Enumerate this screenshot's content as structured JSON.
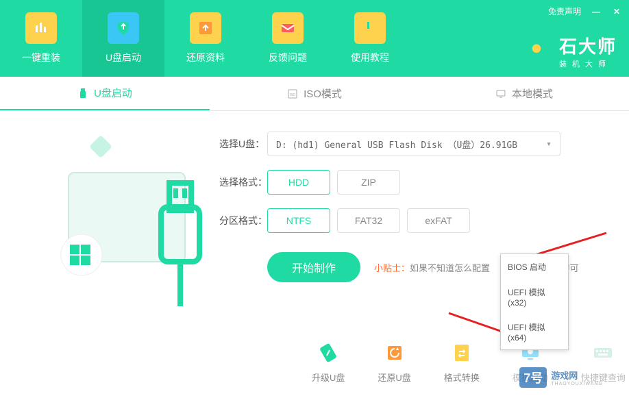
{
  "window": {
    "disclaimer": "免责声明",
    "minimize": "—",
    "close": "✕"
  },
  "brand": {
    "title": "石大师",
    "subtitle": "装机大师"
  },
  "nav": [
    {
      "label": "一键重装",
      "name": "nav-reinstall"
    },
    {
      "label": "U盘启动",
      "name": "nav-usb-boot"
    },
    {
      "label": "还原资料",
      "name": "nav-restore"
    },
    {
      "label": "反馈问题",
      "name": "nav-feedback"
    },
    {
      "label": "使用教程",
      "name": "nav-tutorial"
    }
  ],
  "modes": [
    {
      "label": "U盘启动",
      "name": "mode-usb"
    },
    {
      "label": "ISO模式",
      "name": "mode-iso"
    },
    {
      "label": "本地模式",
      "name": "mode-local"
    }
  ],
  "form": {
    "select_label": "选择U盘：",
    "select_value": "D: (hd1) General USB Flash Disk （U盘）26.91GB",
    "format_label": "选择格式：",
    "format_options": [
      "HDD",
      "ZIP"
    ],
    "partition_label": "分区格式：",
    "partition_options": [
      "NTFS",
      "FAT32",
      "exFAT"
    ]
  },
  "action": {
    "start": "开始制作",
    "tip_label": "小贴士：",
    "tip_text": "如果不知道怎么配置",
    "tip_tail": "即可"
  },
  "tools": [
    {
      "label": "升级U盘",
      "name": "tool-upgrade"
    },
    {
      "label": "还原U盘",
      "name": "tool-restore"
    },
    {
      "label": "格式转换",
      "name": "tool-convert"
    },
    {
      "label": "模拟启动",
      "name": "tool-simulate"
    },
    {
      "label": "快捷键查询",
      "name": "tool-hotkey"
    }
  ],
  "dropdown": {
    "items": [
      "BIOS 启动",
      "UEFI 模拟(x32)",
      "UEFI 模拟(x64)"
    ]
  },
  "watermark": {
    "badge": "7号",
    "text": "游戏网",
    "sub": "THAOYOUXIWANG"
  }
}
